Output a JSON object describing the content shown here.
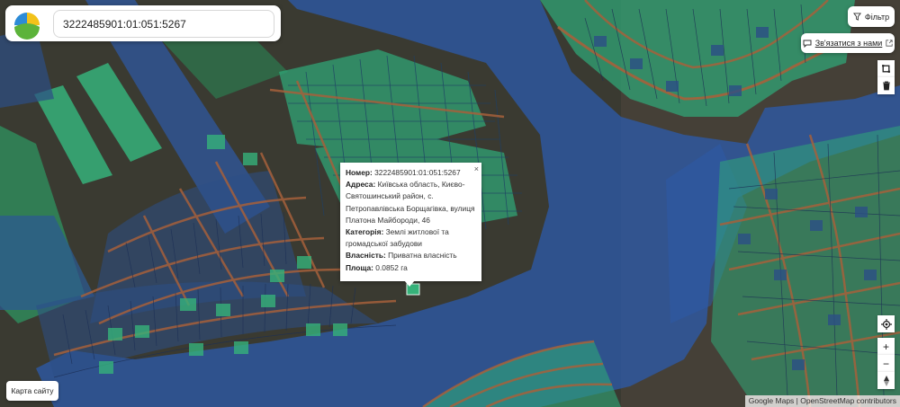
{
  "search": {
    "value": "3222485901:01:051:5267"
  },
  "toolbar": {
    "filter_label": "Фільтр",
    "contact_label": "Зв'язатися з нами"
  },
  "popup": {
    "number_label": "Номер:",
    "number_value": "3222485901:01:051:5267",
    "address_label": "Адреса:",
    "address_value": "Київська область, Києво-Святошинський район, с. Петропавлівська Борщагівка, вулиця Платона Майбороди, 46",
    "category_label": "Категорія:",
    "category_value": "Землі житлової та громадської забудови",
    "ownership_label": "Власність:",
    "ownership_value": "Приватна власність",
    "area_label": "Площа:",
    "area_value": "0.0852 га",
    "close_glyph": "×"
  },
  "footer": {
    "sitemap_label": "Карта сайту",
    "attribution_text": "Google Maps | OpenStreetMap contributors"
  },
  "controls": {
    "zoom_in": "+",
    "zoom_out": "−"
  },
  "icons": [
    "logo-icon",
    "filter-icon",
    "chat-icon",
    "external-link-icon",
    "draw-polygon-icon",
    "trash-icon",
    "locate-icon",
    "compass-icon"
  ],
  "colors": {
    "parcel_green": "#2fa878",
    "zone_blue": "#2d5aa8",
    "road": "#9b5a3a",
    "terrain": "#3b3a33"
  }
}
